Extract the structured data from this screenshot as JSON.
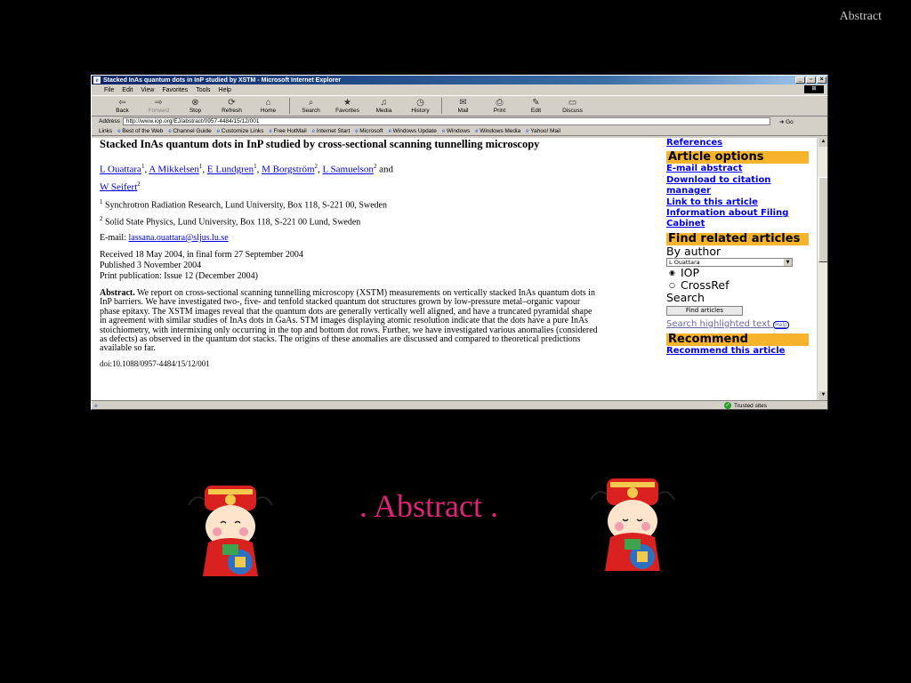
{
  "slide": {
    "corner_title": "Abstract",
    "heading": ". Abstract ."
  },
  "browser": {
    "title": "Stacked InAs quantum dots in InP studied by XSTM - Microsoft Internet Explorer",
    "menu": [
      "File",
      "Edit",
      "View",
      "Favorites",
      "Tools",
      "Help"
    ],
    "toolbar": [
      {
        "label": "Back",
        "icon": "back-arrow-icon",
        "glyph": "⇦"
      },
      {
        "label": "Forward",
        "icon": "forward-arrow-icon",
        "glyph": "⇨"
      },
      {
        "label": "Stop",
        "icon": "stop-icon",
        "glyph": "⊗"
      },
      {
        "label": "Refresh",
        "icon": "refresh-icon",
        "glyph": "⟳"
      },
      {
        "label": "Home",
        "icon": "home-icon",
        "glyph": "⌂"
      },
      {
        "label": "Search",
        "icon": "search-icon",
        "glyph": "⌕"
      },
      {
        "label": "Favorites",
        "icon": "favorites-icon",
        "glyph": "★"
      },
      {
        "label": "Media",
        "icon": "media-icon",
        "glyph": "♫"
      },
      {
        "label": "History",
        "icon": "history-icon",
        "glyph": "◷"
      },
      {
        "label": "Mail",
        "icon": "mail-icon",
        "glyph": "✉"
      },
      {
        "label": "Print",
        "icon": "print-icon",
        "glyph": "⎙"
      },
      {
        "label": "Edit",
        "icon": "edit-icon",
        "glyph": "✎"
      },
      {
        "label": "Discuss",
        "icon": "discuss-icon",
        "glyph": "▭"
      }
    ],
    "address_label": "Address",
    "address_url": "http://www.iop.org/EJ/abstract/0957-4484/15/12/001",
    "go_label": "Go",
    "links_label": "Links",
    "links": [
      "Best of the Web",
      "Channel Guide",
      "Customize Links",
      "Free HotMail",
      "Internet Start",
      "Microsoft",
      "Windows Update",
      "Windows",
      "Windows Media",
      "Yahoo! Mail"
    ],
    "status_zone": "Trusted sites"
  },
  "article": {
    "title": "Stacked InAs quantum dots in InP studied by cross-sectional scanning tunnelling microscopy",
    "authors": [
      {
        "name": "L Ouattara",
        "sup": "1"
      },
      {
        "name": "A Mikkelsen",
        "sup": "1"
      },
      {
        "name": "E Lundgren",
        "sup": "1"
      },
      {
        "name": "M Borgström",
        "sup": "2"
      },
      {
        "name": "L Samuelson",
        "sup": "2"
      },
      {
        "name": "W Seifert",
        "sup": "2"
      }
    ],
    "and": "and",
    "affiliations": [
      {
        "sup": "1",
        "text": "Synchrotron Radiation Research, Lund University, Box 118, S-221 00, Sweden"
      },
      {
        "sup": "2",
        "text": "Solid State Physics, Lund University, Box 118, S-221 00 Lund, Sweden"
      }
    ],
    "email_label": "E-mail:",
    "email": "lassana.ouattara@sljus.lu.se",
    "received": "Received 18 May 2004, in final form 27 September 2004",
    "published": "Published 3 November 2004",
    "print_pub": "Print publication: Issue 12 (December 2004)",
    "abstract_label": "Abstract.",
    "abstract_text": "We report on cross-sectional scanning tunnelling microscopy (XSTM) measurements on vertically stacked InAs quantum dots in InP barriers. We have investigated two-, five- and tenfold stacked quantum dot structures grown by low-pressure metal–organic vapour phase epitaxy. The XSTM images reveal that the quantum dots are generally vertically well aligned, and have a truncated pyramidal shape in agreement with similar studies of InAs dots in GaAs. STM images displaying atomic resolution indicate that the dots have a pure InAs stoichiometry, with intermixing only occurring in the top and bottom dot rows. Further, we have investigated various anomalies (considered as defects) as observed in the quantum dot stacks. The origins of these anomalies are discussed and compared to theoretical predictions available so far.",
    "doi": "doi:10.1088/0957-4484/15/12/001"
  },
  "sidebar": {
    "references": "References",
    "article_options_head": "Article options",
    "article_options": [
      "E-mail abstract",
      "Download to citation manager",
      "Link to this article",
      "Information about Filing Cabinet"
    ],
    "find_related_head": "Find related articles",
    "by_author": "By author",
    "author_select": "L Ouattara",
    "radio_iop": "IOP",
    "radio_crossref": "CrossRef",
    "search_label": "Search",
    "find_button": "Find articles",
    "search_highlighted": "Search highlighted text",
    "help": "Help",
    "recommend_head": "Recommend",
    "recommend_link": "Recommend this article"
  },
  "colors": {
    "heading": "#e0247a",
    "sidebar_header": "#f7b32b",
    "link": "#0000ee"
  }
}
